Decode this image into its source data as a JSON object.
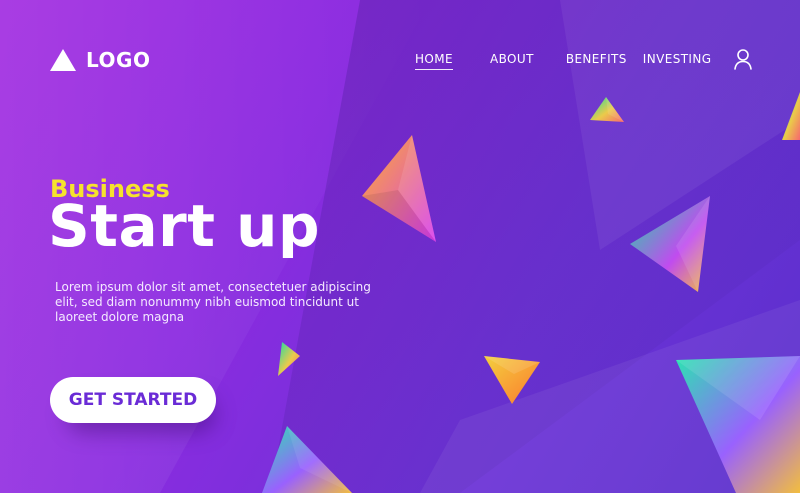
{
  "header": {
    "logo_text": "LOGO",
    "nav": [
      {
        "label": "HOME",
        "active": true
      },
      {
        "label": "ABOUT",
        "active": false
      },
      {
        "label": "BENEFITS",
        "active": false
      },
      {
        "label": "INVESTING",
        "active": false
      }
    ]
  },
  "hero": {
    "kicker": "Business",
    "title": "Start up",
    "body": "Lorem ipsum dolor sit amet, consectetuer adipiscing elit, sed diam nonummy nibh euismod tincidunt ut laoreet dolore magna",
    "cta_label": "GET STARTED"
  },
  "colors": {
    "kicker": "#f6e22d",
    "cta_text": "#6a2bd6",
    "background_start": "#a12ae0",
    "background_end": "#5a2fcc"
  },
  "icons": {
    "logo": "triangle-logo-icon",
    "user": "user-icon"
  }
}
